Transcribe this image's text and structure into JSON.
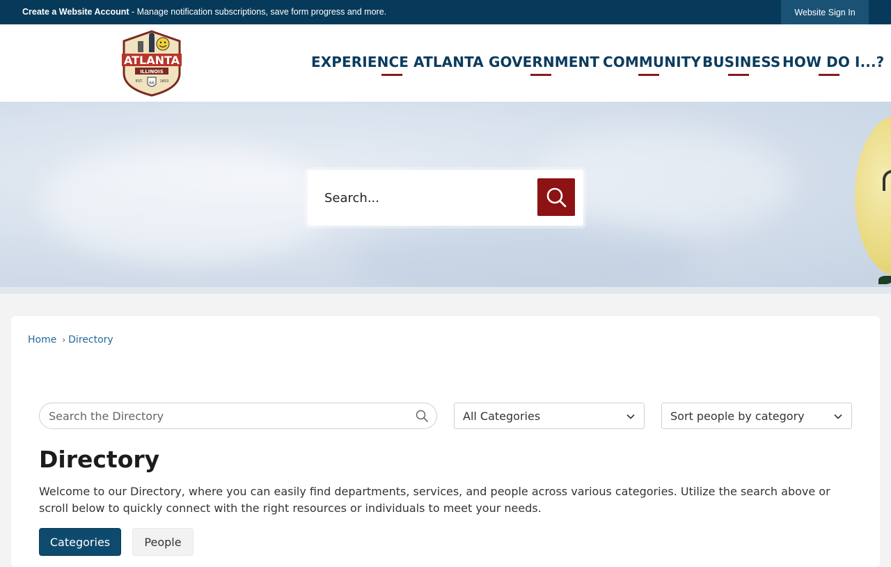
{
  "topbar": {
    "account_bold": "Create a Website Account",
    "account_rest": " - Manage notification subscriptions, save form progress and more.",
    "signin": "Website Sign In"
  },
  "logo": {
    "name": "ATLANTA",
    "state": "ILLINOIS",
    "est": "EST. 1853",
    "route": "66"
  },
  "nav": {
    "items": [
      {
        "label": "EXPERIENCE ATLANTA"
      },
      {
        "label": "GOVERNMENT"
      },
      {
        "label": "COMMUNITY"
      },
      {
        "label": "BUSINESS"
      },
      {
        "label": "HOW DO I...?"
      }
    ]
  },
  "hero": {
    "search_placeholder": "Search..."
  },
  "breadcrumb": {
    "home": "Home",
    "sep": "›",
    "current": "Directory"
  },
  "filters": {
    "search_placeholder": "Search the Directory",
    "category_value": "All Categories",
    "sort_value": "Sort people by category"
  },
  "main": {
    "title": "Directory",
    "intro": "Welcome to our Directory, where you can easily find departments, services, and people across various categories. Utilize the search above or scroll below to quickly connect with the right resources or individuals to meet your needs.",
    "tabs": [
      {
        "label": "Categories",
        "active": true
      },
      {
        "label": "People",
        "active": false
      }
    ]
  },
  "colors": {
    "topbar": "#073a5a",
    "nav_text": "#0b3b5e",
    "accent_red": "#8c1214",
    "active_tab": "#0e4a6e",
    "link": "#1f6a9a"
  }
}
